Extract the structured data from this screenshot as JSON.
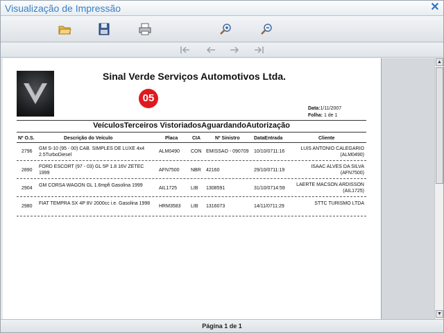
{
  "window": {
    "title": "Visualização de Impressão",
    "close_icon": "close-x-icon"
  },
  "toolbar": {
    "icons": [
      "open-folder-icon",
      "save-disk-icon",
      "print-icon",
      "zoom-in-icon",
      "zoom-out-icon"
    ]
  },
  "navigation": {
    "icons": [
      "first-page-icon",
      "previous-page-icon",
      "next-page-icon",
      "last-page-icon"
    ]
  },
  "report": {
    "company": "Sinal Verde Serviços Automotivos Ltda.",
    "badge": "05",
    "date_label": "Data:",
    "date_value": "1/11/2007",
    "sheet_label": "Folha:",
    "sheet_value": "1 de 1",
    "title": "VeículosTerceiros VistoriadosAguardandoAutorização",
    "columns": {
      "os": "Nº O.S.",
      "vehicle": "Descrição do Veículo",
      "plate": "Placa",
      "cia": "CIA",
      "claim": "Nº Sinistro",
      "entry": "DataEntrada",
      "client": "Cliente"
    },
    "rows": [
      {
        "os": "2796",
        "vehicle_l1": "GM S-10 (95 - 00) CAB. SIMPLES DE LUXE 4x4",
        "vehicle_l2": "2.5TurboDiesel",
        "plate": "ALM0490",
        "cia": "CON",
        "claim": "EMISSAO - 090709",
        "entry": "10/10/0711:16",
        "client_l1": "LUIS ANTONIO CALEGARIO",
        "client_l2": "(ALM0490)"
      },
      {
        "os": "2890",
        "vehicle_l1": "FORD ESCORT (97 - 03) GL 5P 1.8 16V ZETEC",
        "vehicle_l2": "1999",
        "plate": "AFN7500",
        "cia": "NBR",
        "claim": "42160",
        "entry": "29/10/0711:19",
        "client_l1": "ISAAC ALVES DA SILVA",
        "client_l2": "(AFN7500)"
      },
      {
        "os": "2904",
        "vehicle_l1": "GM CORSA WAGON GL 1.6mpfi Gasolina 1999",
        "vehicle_l2": "",
        "plate": "AIL1725",
        "cia": "LIB",
        "claim": "1308591",
        "entry": "31/10/0714:59",
        "client_l1": "LAERTE MACSON ARDISSON",
        "client_l2": "(AIL1725)"
      },
      {
        "os": "2980",
        "vehicle_l1": "FIAT TEMPRA SX 4P 8V 2000cc i.e. Gasolina 1998",
        "vehicle_l2": "",
        "plate": "HRM3583",
        "cia": "LIB",
        "claim": "1316073",
        "entry": "14/11/0711:29",
        "client_l1": "STTC TURISMO LTDA",
        "client_l2": ""
      }
    ]
  },
  "status": {
    "page": "Página 1 de 1"
  }
}
